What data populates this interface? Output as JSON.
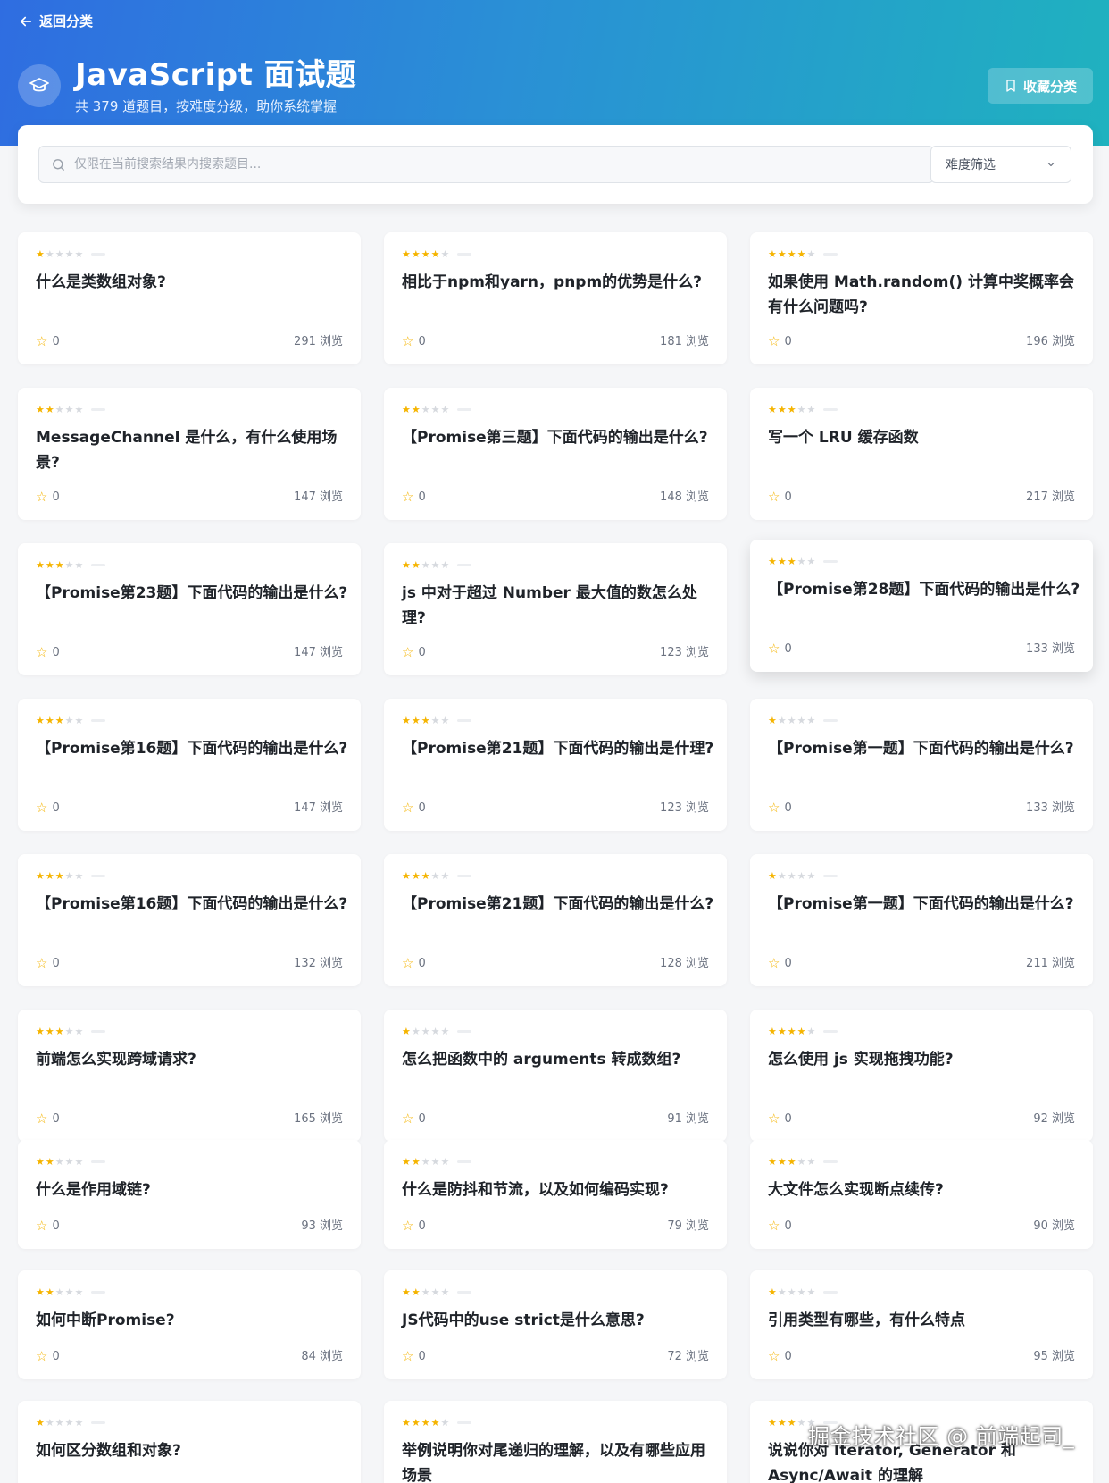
{
  "header": {
    "back_label": "返回分类",
    "title": "JavaScript 面试题",
    "subtitle": "共 379 道题目，按难度分级，助你系统掌握",
    "favorite_label": "收藏分类"
  },
  "search": {
    "placeholder": "仅限在当前搜索结果内搜索题目...",
    "filter_label": "难度筛选"
  },
  "colors": {
    "accent_gradient_start": "#2f6de1",
    "accent_gradient_end": "#1fb2bf",
    "star": "#f5b400"
  },
  "questions": [
    {
      "stars": 1,
      "title": "什么是类数组对象?",
      "favorites": "0",
      "views": "291 浏览"
    },
    {
      "stars": 4,
      "title": "相比于npm和yarn，pnpm的优势是什么?",
      "favorites": "0",
      "views": "181 浏览"
    },
    {
      "stars": 4,
      "title": "如果使用 Math.random() 计算中奖概率会有什么问题吗?",
      "favorites": "0",
      "views": "196 浏览"
    },
    {
      "stars": 2,
      "title": "MessageChannel 是什么，有什么使用场景?",
      "favorites": "0",
      "views": "147 浏览"
    },
    {
      "stars": 2,
      "title": "【Promise第三题】下面代码的输出是什么?",
      "favorites": "0",
      "views": "148 浏览"
    },
    {
      "stars": 3,
      "title": "写一个 LRU 缓存函数",
      "favorites": "0",
      "views": "217 浏览"
    },
    {
      "stars": 3,
      "title": "【Promise第23题】下面代码的输出是什么?",
      "favorites": "0",
      "views": "147 浏览"
    },
    {
      "stars": 2,
      "title": "js 中对于超过 Number 最大值的数怎么处理?",
      "favorites": "0",
      "views": "123 浏览"
    },
    {
      "stars": 3,
      "title": "【Promise第28题】下面代码的输出是什么?",
      "favorites": "0",
      "views": "133 浏览"
    },
    {
      "stars": 3,
      "title": "【Promise第16题】下面代码的输出是什么?",
      "favorites": "0",
      "views": "147 浏览"
    },
    {
      "stars": 3,
      "title": "【Promise第21题】下面代码的输出是什理?",
      "favorites": "0",
      "views": "123 浏览"
    },
    {
      "stars": 1,
      "title": "【Promise第一题】下面代码的输出是什么?",
      "favorites": "0",
      "views": "133 浏览"
    },
    {
      "stars": 3,
      "title": "【Promise第16题】下面代码的输出是什么?",
      "favorites": "0",
      "views": "132 浏览"
    },
    {
      "stars": 3,
      "title": "【Promise第21题】下面代码的输出是什么?",
      "favorites": "0",
      "views": "128 浏览"
    },
    {
      "stars": 1,
      "title": "【Promise第一题】下面代码的输出是什么?",
      "favorites": "0",
      "views": "211 浏览"
    },
    {
      "stars": 3,
      "title": "前端怎么实现跨域请求?",
      "favorites": "0",
      "views": "165 浏览"
    },
    {
      "stars": 1,
      "title": "怎么把函数中的 arguments 转成数组?",
      "favorites": "0",
      "views": "91 浏览"
    },
    {
      "stars": 4,
      "title": "怎么使用 js 实现拖拽功能?",
      "favorites": "0",
      "views": "92 浏览"
    },
    {
      "stars": 2,
      "title": "什么是作用域链?",
      "favorites": "0",
      "views": "93 浏览"
    },
    {
      "stars": 2,
      "title": "什么是防抖和节流，以及如何编码实现?",
      "favorites": "0",
      "views": "79 浏览"
    },
    {
      "stars": 3,
      "title": "大文件怎么实现断点续传?",
      "favorites": "0",
      "views": "90 浏览"
    },
    {
      "stars": 2,
      "title": "如何中断Promise?",
      "favorites": "0",
      "views": "84 浏览"
    },
    {
      "stars": 2,
      "title": "JS代码中的use strict是什么意思?",
      "favorites": "0",
      "views": "72 浏览"
    },
    {
      "stars": 1,
      "title": "引用类型有哪些，有什么特点",
      "favorites": "0",
      "views": "95 浏览"
    },
    {
      "stars": 1,
      "title": "如何区分数组和对象?",
      "favorites": "",
      "views": ""
    },
    {
      "stars": 4,
      "title": "举例说明你对尾递归的理解，以及有哪些应用场景",
      "favorites": "",
      "views": ""
    },
    {
      "stars": 3,
      "title": "说说你对 Iterator, Generator 和 Async/Await 的理解",
      "favorites": "",
      "views": ""
    }
  ],
  "watermark": "掘金技术社区 @ 前端起司_"
}
